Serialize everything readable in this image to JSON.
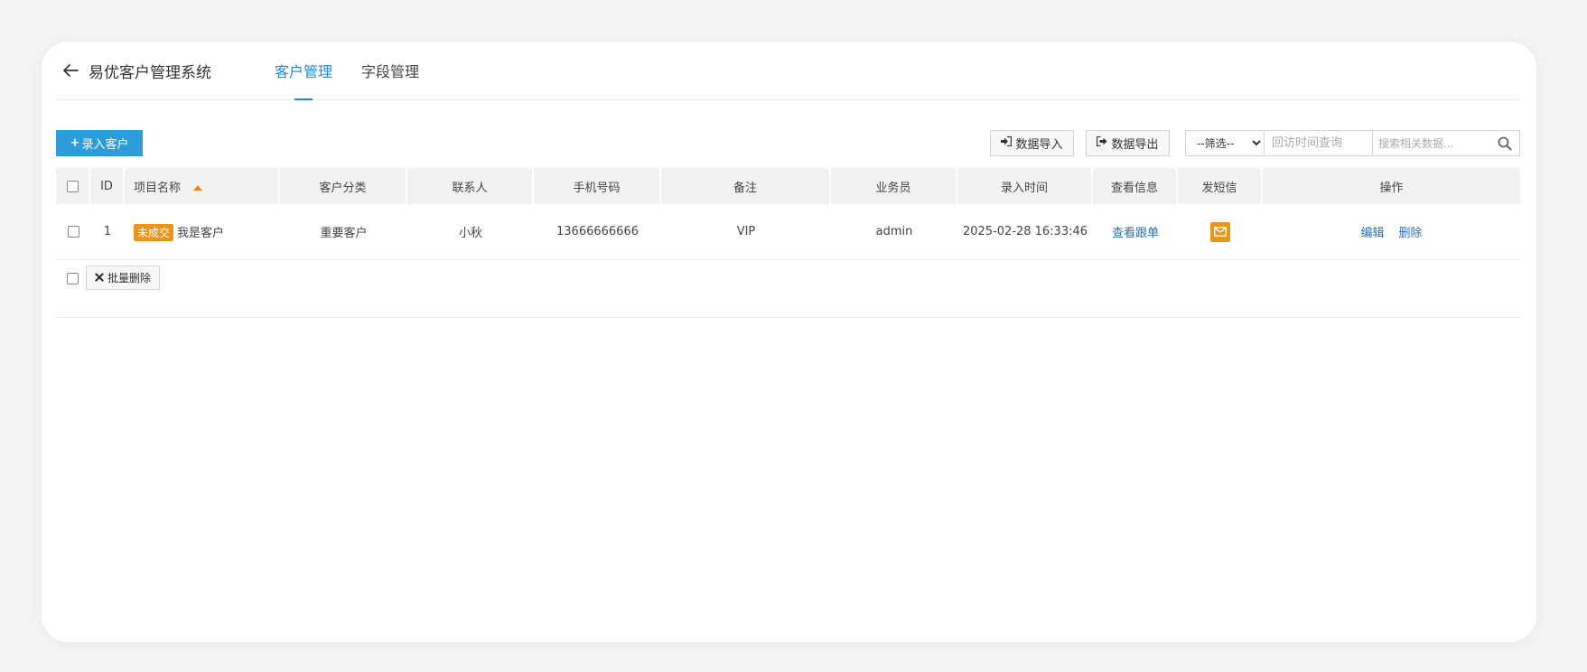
{
  "header": {
    "title": "易优客户管理系统",
    "tabs": [
      {
        "label": "客户管理",
        "active": true
      },
      {
        "label": "字段管理",
        "active": false
      }
    ]
  },
  "toolbar": {
    "add_label": "录入客户",
    "import_label": "数据导入",
    "export_label": "数据导出",
    "filter_selected": "--筛选--",
    "date_placeholder": "回访时间查询",
    "search_placeholder": "搜索相关数据..."
  },
  "table": {
    "columns": [
      "ID",
      "项目名称",
      "客户分类",
      "联系人",
      "手机号码",
      "备注",
      "业务员",
      "录入时间",
      "查看信息",
      "发短信",
      "操作"
    ],
    "rows": [
      {
        "id": "1",
        "status": "未成交",
        "name": "我是客户",
        "category": "重要客户",
        "contact": "小秋",
        "phone": "13666666666",
        "remark": "VIP",
        "salesman": "admin",
        "created": "2025-02-28 16:33:46",
        "view_label": "查看跟单",
        "edit_label": "编辑",
        "delete_label": "删除"
      }
    ]
  },
  "footer": {
    "batch_delete_label": "批量删除"
  },
  "colors": {
    "accent": "#2d9cdb",
    "tab_active": "#1e88e5",
    "badge": "#e8951e",
    "link": "#2f6fb0"
  }
}
